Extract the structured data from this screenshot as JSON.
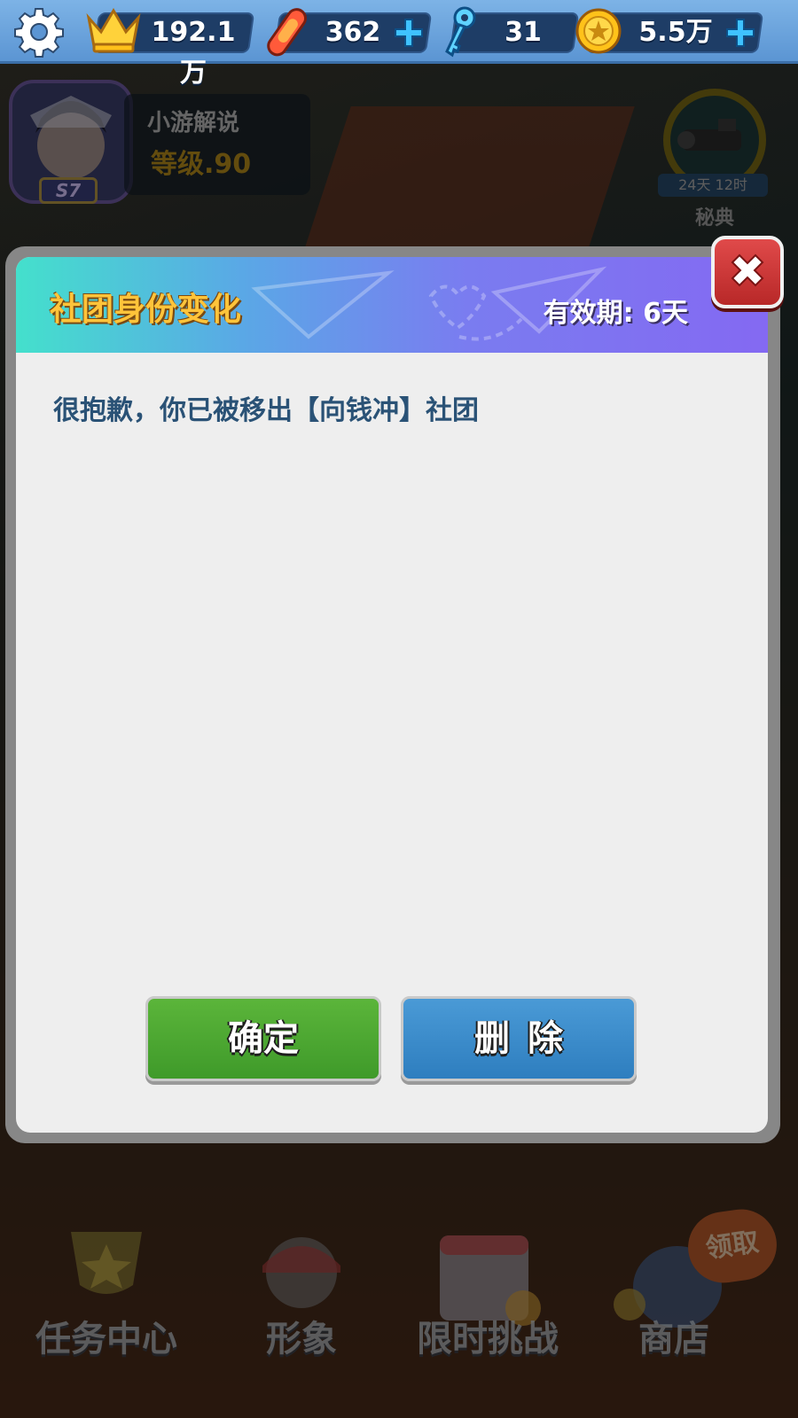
{
  "topbar": {
    "settings_icon": "gear-icon",
    "crown": {
      "icon": "crown-icon",
      "value": "192.1万"
    },
    "skateboard": {
      "icon": "skateboard-icon",
      "value": "362"
    },
    "key": {
      "icon": "key-icon",
      "value": "31"
    },
    "coin": {
      "icon": "coin-icon",
      "value": "5.5万"
    }
  },
  "background": {
    "player_name": "小游解说",
    "player_level": "等级.90",
    "avatar_badge": "S7",
    "secret_timer": "24天 12时",
    "secret_label": "秘典",
    "menu": [
      "任务中心",
      "形象",
      "限时挑战",
      "商店"
    ],
    "claim_badge": "领取"
  },
  "dialog": {
    "title": "社团身份变化",
    "validity": "有效期: 6天",
    "message": "很抱歉，你已被移出【向钱冲】社团",
    "confirm_label": "确定",
    "delete_label": "删除"
  },
  "colors": {
    "title": "#ffc43a",
    "message": "#2a5276",
    "confirm_bg": "#4aa62e",
    "delete_bg": "#3588c8",
    "close_bg": "#c83232"
  }
}
